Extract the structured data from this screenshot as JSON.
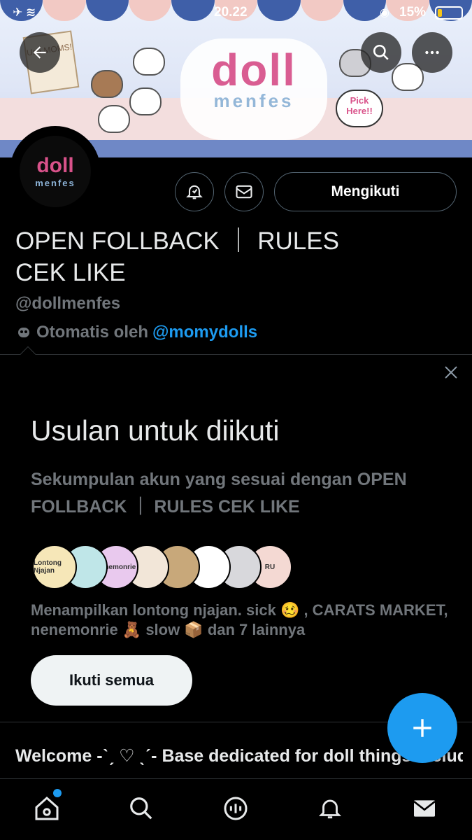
{
  "status_bar": {
    "time": "20.22",
    "battery": "15%",
    "battery_level": 0.15
  },
  "banner": {
    "logo_main": "doll",
    "logo_sub": "menfes",
    "sign_text": "Use MOMS!",
    "pick_text": "Pick Here!!"
  },
  "avatar": {
    "line1": "doll",
    "line2": "menfes"
  },
  "profile": {
    "follow_label": "Mengikuti",
    "name_line1": "OPEN FOLLBACK ｜ RULES",
    "name_line2": "CEK LIKE",
    "handle": "@dollmenfes",
    "automated_prefix": "Otomatis oleh",
    "automated_by": "@momydolls"
  },
  "suggestion": {
    "title": "Usulan untuk diikuti",
    "description": "Sekumpulan akun yang sesuai dengan OPEN FOLLBACK ｜ RULES CEK LIKE",
    "faces": [
      {
        "label": "Lontong Njajan",
        "color": "#f6e7b8"
      },
      {
        "label": "",
        "color": "#bfe6e8"
      },
      {
        "label": "nenemonrie",
        "color": "#e9c9ee"
      },
      {
        "label": "",
        "color": "#f2e6d8"
      },
      {
        "label": "",
        "color": "#c8a87a"
      },
      {
        "label": "",
        "color": "#ffffff"
      },
      {
        "label": "",
        "color": "#d8d8dc"
      },
      {
        "label": "RU",
        "color": "#f4d9d3"
      }
    ],
    "showing_text": "Menampilkan lontong njajan. sick 🥴 , CARATS MARKET, nenemonrie 🧸 slow 📦 dan 7 lainnya",
    "follow_all_label": "Ikuti semua"
  },
  "bio": {
    "text": "Welcome -ˋˏ ♡ ˎˊ- Base dedicated for doll things including buying, selling, trading and giving"
  },
  "tabs": [
    {
      "name": "home-icon"
    },
    {
      "name": "search-icon"
    },
    {
      "name": "spaces-icon"
    },
    {
      "name": "bell-icon"
    },
    {
      "name": "mail-icon"
    }
  ],
  "colors": {
    "accent": "#1d9bf0",
    "background": "#000000",
    "muted": "#71767b"
  }
}
